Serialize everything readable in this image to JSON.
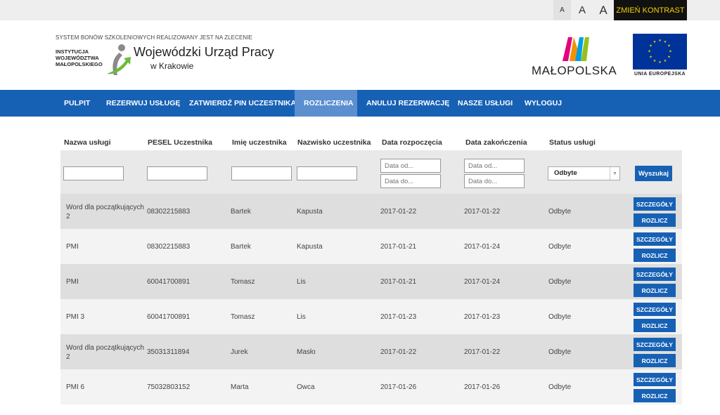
{
  "accessibility": {
    "font_small": "A",
    "font_medium": "A",
    "font_large": "A",
    "contrast": "ZMIEŃ KONTRAST"
  },
  "header": {
    "system_note": "SYSTEM BONÓW SZKOLENIOWYCH REALIZOWANY JEST NA ZLECENIE",
    "institution": "INSTYTUCJA WOJEWÓDZTWA MAŁOPOLSKIEGO",
    "office_name": "Wojewódzki Urząd Pracy",
    "office_city": "w Krakowie",
    "region_name": "MAŁOPOLSKA",
    "eu_name": "UNIA EUROPEJSKA"
  },
  "nav": {
    "items": [
      {
        "label": "PULPIT"
      },
      {
        "label": "REZERWUJ USŁUGĘ"
      },
      {
        "label": "ZATWIERDŹ PIN UCZESTNIKA"
      },
      {
        "label": "ROZLICZENIA"
      },
      {
        "label": "ANULUJ REZERWACJĘ"
      },
      {
        "label": "NASZE USŁUGI"
      },
      {
        "label": "WYLOGUJ"
      }
    ],
    "active": "ROZLICZENIA"
  },
  "table": {
    "columns": [
      "Nazwa usługi",
      "PESEL Uczestnika",
      "Imię uczestnika",
      "Nazwisko uczestnika",
      "Data rozpoczęcia",
      "Data zakończenia",
      "Status usługi"
    ],
    "filters": {
      "service_name": "",
      "pesel": "",
      "first_name": "",
      "last_name": "",
      "start_from_placeholder": "Data od...",
      "start_to_placeholder": "Data do...",
      "end_from_placeholder": "Data od...",
      "end_to_placeholder": "Data do...",
      "status": "Odbyte",
      "search_label": "Wyszukaj"
    },
    "details_label": "SZCZEGÓŁY",
    "settle_label": "ROZLICZ",
    "rows": [
      {
        "service": "Word dla początkujących 2",
        "pesel": "08302215883",
        "first": "Bartek",
        "last": "Kapusta",
        "start": "2017-01-22",
        "end": "2017-01-22",
        "status": "Odbyte"
      },
      {
        "service": "PMI",
        "pesel": "08302215883",
        "first": "Bartek",
        "last": "Kapusta",
        "start": "2017-01-21",
        "end": "2017-01-24",
        "status": "Odbyte"
      },
      {
        "service": "PMI",
        "pesel": "60041700891",
        "first": "Tomasz",
        "last": "Lis",
        "start": "2017-01-21",
        "end": "2017-01-24",
        "status": "Odbyte"
      },
      {
        "service": "PMI 3",
        "pesel": "60041700891",
        "first": "Tomasz",
        "last": "Lis",
        "start": "2017-01-23",
        "end": "2017-01-23",
        "status": "Odbyte"
      },
      {
        "service": "Word dla początkujących 2",
        "pesel": "35031311894",
        "first": "Jurek",
        "last": "Masło",
        "start": "2017-01-22",
        "end": "2017-01-22",
        "status": "Odbyte"
      },
      {
        "service": "PMI 6",
        "pesel": "75032803152",
        "first": "Marta",
        "last": "Owca",
        "start": "2017-01-26",
        "end": "2017-01-26",
        "status": "Odbyte"
      }
    ]
  },
  "colors": {
    "nav_bg": "#1761b5",
    "nav_active": "#5b8fd0",
    "button_blue": "#1761b5",
    "contrast_text": "#f5d200"
  }
}
